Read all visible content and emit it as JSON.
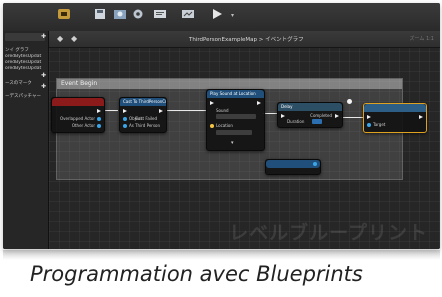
{
  "toolbar": {
    "buttons": [
      {
        "label": "",
        "icon": "blueprint-icon"
      },
      {
        "label": "",
        "icon": "save-icon"
      },
      {
        "label": "",
        "icon": "find-in-content-icon"
      },
      {
        "label": "",
        "icon": "class-settings-icon"
      },
      {
        "label": "",
        "icon": "class-defaults-icon"
      },
      {
        "label": "",
        "icon": "play-icon"
      }
    ]
  },
  "left_panel": {
    "items": [
      "ンイ グラフ",
      "oredBytesUpdat",
      "oredBytesUpdat",
      "oredBytesUpdat",
      "ースのマーク",
      "ーデスパッチャー"
    ]
  },
  "graph": {
    "breadcrumb": "ThirdPersonExampleMap > イベントグラフ",
    "zoom": "ズーム 1:1",
    "comment_title": "Event Begin",
    "watermark": "レベルブループリント",
    "nodes": {
      "event": {
        "title": "",
        "pins": [
          "Overlapped Actor",
          "Other Actor"
        ]
      },
      "cast": {
        "title": "Cast To ThirdPersonCharacter",
        "pins": [
          "Object",
          "Cast Failed",
          "As Third Person"
        ]
      },
      "sound": {
        "title": "Play Sound at Location",
        "pins": [
          "Sound",
          "Location"
        ]
      },
      "delay": {
        "title": "Delay",
        "pins": [
          "Duration",
          "Completed"
        ]
      },
      "target": {
        "title": "",
        "pins": [
          "Target"
        ]
      },
      "ref": {
        "title": "",
        "pins": []
      }
    }
  },
  "caption": "Programmation avec Blueprints",
  "colors": {
    "graph_bg": "#262626",
    "event_header": "#8b1a1a",
    "cast_header": "#1f4f7a",
    "sound_header": "#1f4f7a",
    "delay_header": "#2d4f66",
    "target_header": "#2d5f86",
    "exec_pin": "#f0f0f0",
    "object_pin": "#3aa6e8",
    "vector_pin": "#f5c542"
  }
}
